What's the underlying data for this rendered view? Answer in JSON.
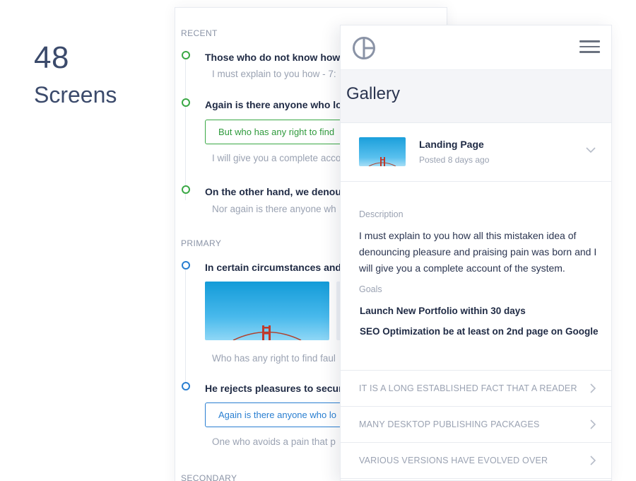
{
  "hero": {
    "count": "48",
    "label": "Screens"
  },
  "timeline": {
    "recent_heading": "RECENT",
    "recent_items": [
      {
        "title": "Those who do not know how t",
        "sub": "I must explain to you how - 7:"
      },
      {
        "title": "Again is there anyone who lov",
        "action": "But who has any right to find",
        "sub": "I will give you a complete acco"
      },
      {
        "title": "On the other hand, we denour",
        "sub": "Nor again is there anyone wh"
      }
    ],
    "primary_heading": "PRIMARY",
    "primary_items": [
      {
        "title": "In certain circumstances and c",
        "sub": "Who has any right to find faul"
      },
      {
        "title": "He rejects pleasures to secure",
        "action": "Again is there anyone who lo",
        "sub": "One who avoids a pain that p"
      }
    ],
    "secondary_heading": "SECONDARY"
  },
  "gallery": {
    "title": "Gallery",
    "item": {
      "title": "Landing Page",
      "meta": "Posted 8 days ago"
    },
    "description_label": "Description",
    "description": "I must explain to you how all this mistaken idea of denouncing pleasure and praising pain was born and I will give you a complete account of the system.",
    "goals_label": "Goals",
    "goals": [
      "Launch New Portfolio within 30 days",
      "SEO Optimization be at least on 2nd page on Google"
    ],
    "accordion": [
      "IT IS A LONG ESTABLISHED FACT THAT A READER",
      "MANY DESKTOP PUBLISHING PACKAGES",
      "VARIOUS VERSIONS HAVE EVOLVED OVER"
    ]
  },
  "colors": {
    "green": "#3aa845",
    "blue": "#2a7fd1",
    "text": "#1f2a44",
    "muted": "#9aa2b2"
  },
  "icons": {
    "logo": "circle-split-logo-icon",
    "menu": "hamburger-icon",
    "expand": "chevron-down-icon",
    "next": "chevron-right-icon"
  }
}
